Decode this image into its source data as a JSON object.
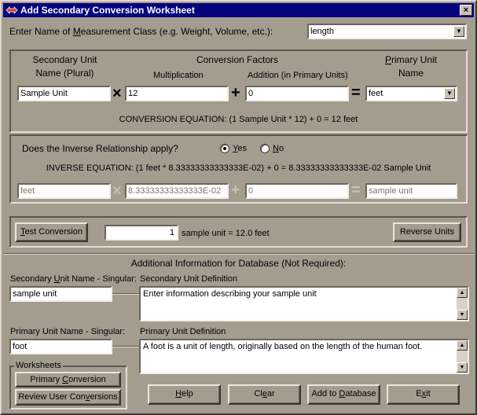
{
  "window": {
    "title": "Add Secondary Conversion Worksheet",
    "close_glyph": "×"
  },
  "measurement_class": {
    "label_pre": "Enter Name of ",
    "label_u": "M",
    "label_post": "easurement Class (e.g. Weight, Volume, etc.):",
    "value": "length"
  },
  "headers": {
    "secondary_line1": "Secondary Unit",
    "secondary_line2": "Name (Plural)",
    "conversion_factors": "Conversion Factors",
    "multiplication": "Multiplication",
    "addition": "Addition (in Primary Units)",
    "primary_u": "P",
    "primary_rest": "rimary Unit",
    "primary_line2": "Name"
  },
  "conversion": {
    "secondary_unit": "Sample Unit",
    "multiplication": "12",
    "addition": "0",
    "primary_unit": "feet",
    "times": "×",
    "plus": "+",
    "equals": "=",
    "equation": "CONVERSION EQUATION:  (1 Sample Unit  *  12) + 0 = 12 feet"
  },
  "inverse": {
    "question": "Does the Inverse Relationship apply?",
    "yes_u": "Y",
    "yes_rest": "es",
    "no_u": "N",
    "no_rest": "o",
    "equation": "INVERSE EQUATION:  (1 feet  *  8.33333333333333E-02) +  0 = 8.33333333333333E-02 Sample Unit",
    "from_unit": "feet",
    "multiplication": "8.33333333333333E-02",
    "addition": "0",
    "to_unit": "sample unit"
  },
  "test": {
    "button_u": "T",
    "button_rest": "est Conversion",
    "amount": "1",
    "result": "sample unit = 12.0 feet",
    "reverse_button": "Reverse Units"
  },
  "additional": {
    "heading": "Additional Information for Database (Not Required):",
    "secondary_singular_label_pre": "Secondary ",
    "secondary_singular_label_u": "U",
    "secondary_singular_label_post": "nit Name - Singular:",
    "secondary_singular_value": "sample unit",
    "secondary_definition_label": "Secondary Unit Definition",
    "secondary_definition_value": "Enter information describing your sample unit",
    "primary_singular_label": "Primary Unit Name - Singular:",
    "primary_singular_value": "foot",
    "primary_definition_label": "Primary Unit Definition",
    "primary_definition_value": "A foot is a unit of length, originally based on the length of the human foot."
  },
  "worksheets": {
    "title": "Worksheets",
    "primary_pre": "Primary ",
    "primary_u": "C",
    "primary_post": "onversion",
    "review_pre": "Review User Con",
    "review_u": "v",
    "review_post": "ersions"
  },
  "buttons": {
    "help_u": "H",
    "help_rest": "elp",
    "clear_pre": "Cl",
    "clear_u": "e",
    "clear_post": "ar",
    "add_pre": "Add to ",
    "add_u": "D",
    "add_post": "atabase",
    "exit_pre": "E",
    "exit_u": "x",
    "exit_post": "it"
  },
  "colors": {
    "window_face": "#a59c90",
    "titlebar": "#06057e"
  }
}
